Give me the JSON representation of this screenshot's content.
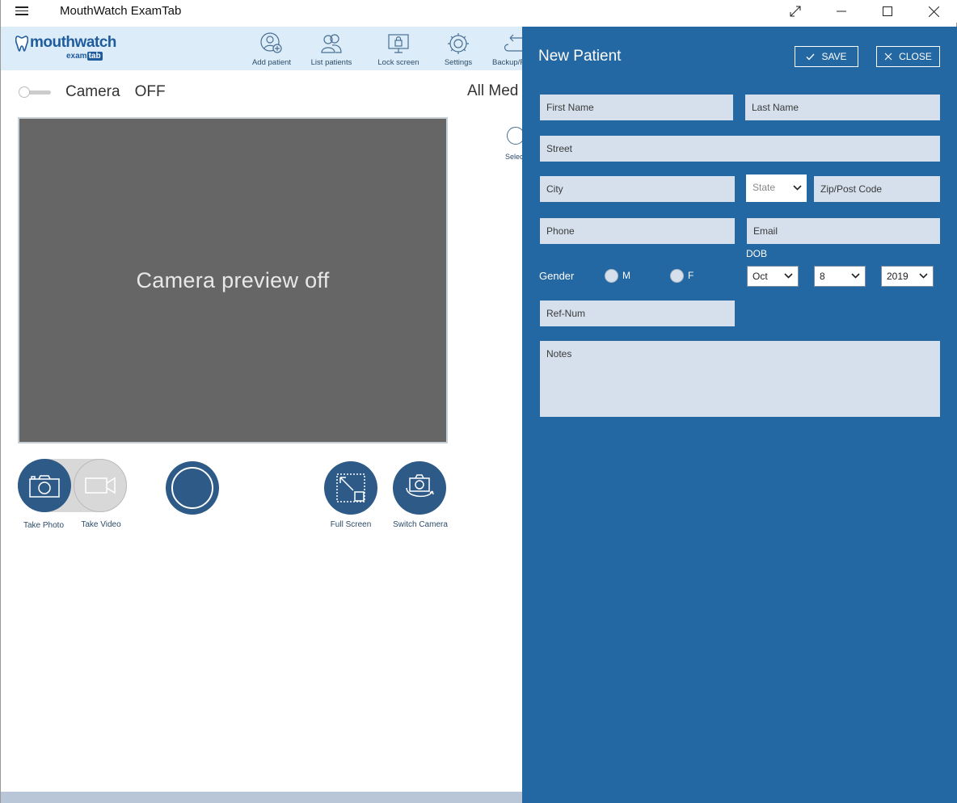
{
  "window": {
    "title": "MouthWatch ExamTab"
  },
  "logo": {
    "main": "mouthwatch",
    "sub_prefix": "exam",
    "sub_badge": "tab"
  },
  "toolbar": {
    "items": [
      {
        "label": "Add patient",
        "icon": "add-patient-icon"
      },
      {
        "label": "List patients",
        "icon": "list-patients-icon"
      },
      {
        "label": "Lock screen",
        "icon": "lock-screen-icon"
      },
      {
        "label": "Settings",
        "icon": "gear-icon"
      },
      {
        "label": "Backup/R",
        "icon": "backup-icon"
      }
    ]
  },
  "camera": {
    "label": "Camera",
    "state": "OFF",
    "preview_text": "Camera preview off"
  },
  "media": {
    "title": "All Med",
    "select_label": "Selec"
  },
  "buttons": {
    "take_photo": "Take Photo",
    "take_video": "Take Video",
    "full_screen": "Full Screen",
    "switch_camera": "Switch Camera"
  },
  "panel": {
    "title": "New Patient",
    "save_label": "SAVE",
    "close_label": "CLOSE",
    "fields": {
      "first_name": "First Name",
      "last_name": "Last Name",
      "street": "Street",
      "city": "City",
      "state": "State",
      "zip": "Zip/Post Code",
      "phone": "Phone",
      "email": "Email",
      "ref_num": "Ref-Num",
      "notes": "Notes"
    },
    "gender": {
      "label": "Gender",
      "male": "M",
      "female": "F"
    },
    "dob": {
      "label": "DOB",
      "month": "Oct",
      "day": "8",
      "year": "2019"
    }
  },
  "colors": {
    "panel": "#2367a3",
    "toolbar": "#dcedf9",
    "accent": "#2d5a86",
    "field": "#d5e0ec"
  }
}
